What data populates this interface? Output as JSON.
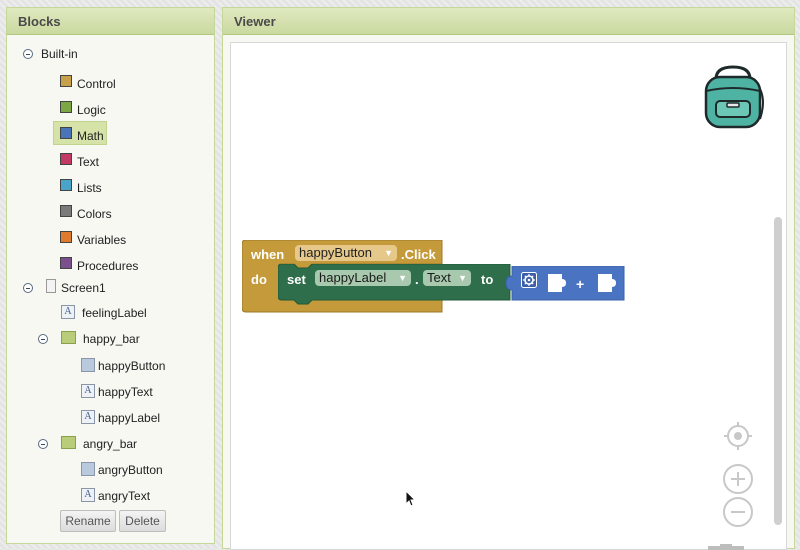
{
  "blocks_panel": {
    "title": "Blocks",
    "builtin_label": "Built-in",
    "categories": [
      {
        "label": "Control",
        "color": "#c9a04a"
      },
      {
        "label": "Logic",
        "color": "#7ba845"
      },
      {
        "label": "Math",
        "color": "#4a74b8"
      },
      {
        "label": "Text",
        "color": "#c23a63"
      },
      {
        "label": "Lists",
        "color": "#4aa3c9"
      },
      {
        "label": "Colors",
        "color": "#7a7a7a"
      },
      {
        "label": "Variables",
        "color": "#e07a2c"
      },
      {
        "label": "Procedures",
        "color": "#7b4f8e"
      }
    ],
    "selected_category": "Math",
    "components": {
      "screen": "Screen1",
      "feeling_label": "feelingLabel",
      "happy_bar": "happy_bar",
      "happy_button": "happyButton",
      "happy_text": "happyText",
      "happy_label": "happyLabel",
      "angry_bar": "angry_bar",
      "angry_button": "angryButton",
      "angry_text": "angryText"
    },
    "rename_label": "Rename",
    "delete_label": "Delete"
  },
  "viewer": {
    "title": "Viewer",
    "event_block": {
      "when": "when",
      "component": "happyButton",
      "event": ".Click",
      "do": "do",
      "color": "#c49a3a"
    },
    "setter_block": {
      "set": "set",
      "component": "happyLabel",
      "dot": ".",
      "property": "Text",
      "to": "to",
      "color": "#2f6e4a"
    },
    "join_block": {
      "plus": "+",
      "color": "#4a74c2"
    }
  }
}
